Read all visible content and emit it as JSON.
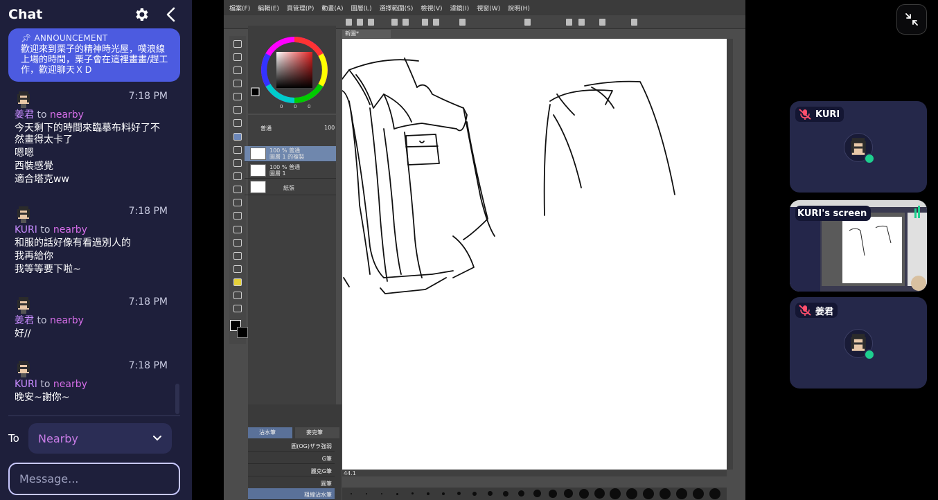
{
  "chat": {
    "title": "Chat",
    "settings_icon": "gear-icon",
    "close_icon": "chevron-left-icon",
    "announcement": {
      "title": "ANNOUNCEMENT",
      "icon": "pin-icon",
      "body": "歡迎來到栗子的精神時光屋，噗浪線上場的時間，栗子會在這裡畫畫/趕工作，歡迎聊天ＸＤ"
    },
    "messages": [
      {
        "sender": "姜君",
        "to": "to",
        "target": "nearby",
        "time": "7:18 PM",
        "lines": [
          "今天剩下的時間來臨摹布料好了不然畫得太卡了",
          "嗯嗯",
          "西裝感覺",
          "適合塔克ww"
        ]
      },
      {
        "sender": "KURI",
        "to": "to",
        "target": "nearby",
        "time": "7:18 PM",
        "lines": [
          "和服的話好像有看過別人的",
          "我再給你",
          "我等等要下啦~"
        ]
      },
      {
        "sender": "姜君",
        "to": "to",
        "target": "nearby",
        "time": "7:18 PM",
        "lines": [
          "好//"
        ]
      },
      {
        "sender": "KURI",
        "to": "to",
        "target": "nearby",
        "time": "7:18 PM",
        "lines": [
          "晚安~謝你~"
        ]
      }
    ],
    "to_label": "To",
    "recipient": "Nearby",
    "input_placeholder": "Message..."
  },
  "screen_share": {
    "menu": [
      "檔案(F)",
      "編輯(E)",
      "頁管理(P)",
      "動畫(A)",
      "圖層(L)",
      "選擇範圍(S)",
      "檢視(V)",
      "濾鏡(I)",
      "視窗(W)",
      "說明(H)"
    ],
    "canvas_tab": "新圖*",
    "layer_mode": "普通",
    "opacity": "100",
    "layers": [
      {
        "line1": "100 % 普通",
        "line2": "圖層 1 的複製"
      },
      {
        "line1": "100 % 普通",
        "line2": "圖層 1"
      },
      {
        "line1": "",
        "line2": "紙張"
      }
    ],
    "brush_tabs": [
      "沾水筆",
      "麥克筆"
    ],
    "brushes": [
      "圓(OG)ザラ強弱",
      "G筆",
      "麗克G筆",
      "圓筆",
      "粗線沾水筆"
    ],
    "zoom": "44.1",
    "color_values": [
      "0",
      "0",
      "0"
    ]
  },
  "video": {
    "collapse_icon": "collapse-icon",
    "tiles": [
      {
        "name": "KURI",
        "muted": true
      },
      {
        "name": "KURI's screen",
        "muted": false
      },
      {
        "name": "姜君",
        "muted": true
      }
    ]
  },
  "colors": {
    "sidebar": "#1e1f3b",
    "announcement": "#4c5be0",
    "accent_pink": "#d56ee8",
    "online": "#1ecf8f",
    "tile": "#25284a"
  }
}
